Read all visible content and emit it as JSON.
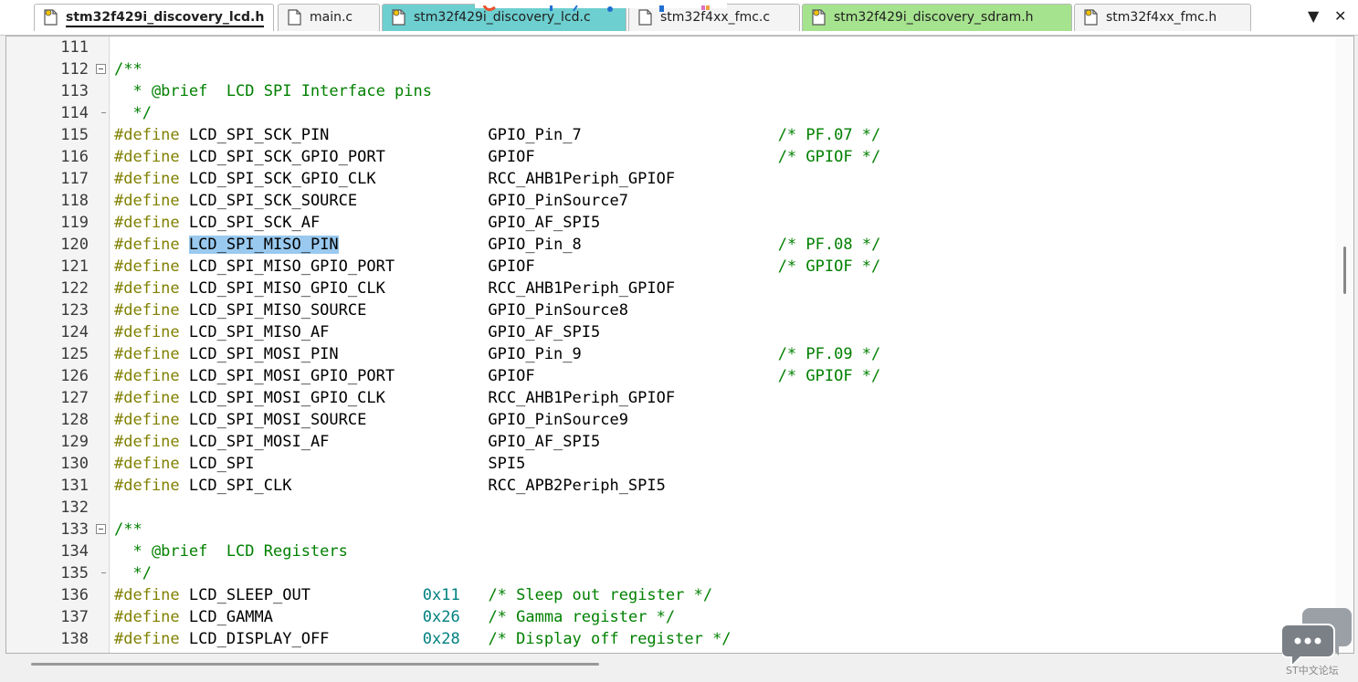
{
  "tabs": [
    {
      "label": "stm32f429i_discovery_lcd.h",
      "active": true,
      "bg": "#ffffff",
      "icon": "header-file-icon"
    },
    {
      "label": "main.c",
      "active": false,
      "bg": "#f4f4f4",
      "icon": "source-file-icon"
    },
    {
      "label": "stm32f429i_discovery_lcd.c",
      "active": false,
      "bg": "#6dcfcf",
      "icon": "header-file-icon"
    },
    {
      "label": "stm32f4xx_fmc.c",
      "active": false,
      "bg": "#f4f4f4",
      "icon": "source-file-icon"
    },
    {
      "label": "stm32f429i_discovery_sdram.h",
      "active": false,
      "bg": "#a6e38f",
      "icon": "header-file-icon"
    },
    {
      "label": "stm32f4xx_fmc.h",
      "active": false,
      "bg": "#f4f4f4",
      "icon": "header-file-icon"
    }
  ],
  "tab_controls": {
    "dropdown": "▼",
    "close": "✕"
  },
  "lines": [
    {
      "n": "111",
      "fold": "",
      "parts": []
    },
    {
      "n": "112",
      "fold": "box",
      "parts": [
        [
          "cm",
          "/**"
        ]
      ]
    },
    {
      "n": "113",
      "fold": "",
      "parts": [
        [
          "cm",
          "  * @brief  LCD SPI Interface pins"
        ]
      ]
    },
    {
      "n": "114",
      "fold": "tick",
      "parts": [
        [
          "cm",
          "  */"
        ]
      ]
    },
    {
      "n": "115",
      "fold": "",
      "parts": [
        [
          "kw",
          "#define"
        ],
        [
          "id",
          " LCD_SPI_SCK_PIN                 GPIO_Pin_7                     "
        ],
        [
          "cm",
          "/* PF.07 */"
        ]
      ]
    },
    {
      "n": "116",
      "fold": "",
      "parts": [
        [
          "kw",
          "#define"
        ],
        [
          "id",
          " LCD_SPI_SCK_GPIO_PORT           GPIOF                          "
        ],
        [
          "cm",
          "/* GPIOF */"
        ]
      ]
    },
    {
      "n": "117",
      "fold": "",
      "parts": [
        [
          "kw",
          "#define"
        ],
        [
          "id",
          " LCD_SPI_SCK_GPIO_CLK            RCC_AHB1Periph_GPIOF"
        ]
      ]
    },
    {
      "n": "118",
      "fold": "",
      "parts": [
        [
          "kw",
          "#define"
        ],
        [
          "id",
          " LCD_SPI_SCK_SOURCE              GPIO_PinSource7"
        ]
      ]
    },
    {
      "n": "119",
      "fold": "",
      "parts": [
        [
          "kw",
          "#define"
        ],
        [
          "id",
          " LCD_SPI_SCK_AF                  GPIO_AF_SPI5"
        ]
      ]
    },
    {
      "n": "120",
      "fold": "",
      "parts": [
        [
          "kw",
          "#define"
        ],
        [
          "id",
          " "
        ],
        [
          "sel",
          "LCD_SPI_MISO_PIN"
        ],
        [
          "id",
          "                GPIO_Pin_8                     "
        ],
        [
          "cm",
          "/* PF.08 */"
        ]
      ]
    },
    {
      "n": "121",
      "fold": "",
      "parts": [
        [
          "kw",
          "#define"
        ],
        [
          "id",
          " LCD_SPI_MISO_GPIO_PORT          GPIOF                          "
        ],
        [
          "cm",
          "/* GPIOF */"
        ]
      ]
    },
    {
      "n": "122",
      "fold": "",
      "parts": [
        [
          "kw",
          "#define"
        ],
        [
          "id",
          " LCD_SPI_MISO_GPIO_CLK           RCC_AHB1Periph_GPIOF"
        ]
      ]
    },
    {
      "n": "123",
      "fold": "",
      "parts": [
        [
          "kw",
          "#define"
        ],
        [
          "id",
          " LCD_SPI_MISO_SOURCE             GPIO_PinSource8"
        ]
      ]
    },
    {
      "n": "124",
      "fold": "",
      "parts": [
        [
          "kw",
          "#define"
        ],
        [
          "id",
          " LCD_SPI_MISO_AF                 GPIO_AF_SPI5"
        ]
      ]
    },
    {
      "n": "125",
      "fold": "",
      "parts": [
        [
          "kw",
          "#define"
        ],
        [
          "id",
          " LCD_SPI_MOSI_PIN                GPIO_Pin_9                     "
        ],
        [
          "cm",
          "/* PF.09 */"
        ]
      ]
    },
    {
      "n": "126",
      "fold": "",
      "parts": [
        [
          "kw",
          "#define"
        ],
        [
          "id",
          " LCD_SPI_MOSI_GPIO_PORT          GPIOF                          "
        ],
        [
          "cm",
          "/* GPIOF */"
        ]
      ]
    },
    {
      "n": "127",
      "fold": "",
      "parts": [
        [
          "kw",
          "#define"
        ],
        [
          "id",
          " LCD_SPI_MOSI_GPIO_CLK           RCC_AHB1Periph_GPIOF"
        ]
      ]
    },
    {
      "n": "128",
      "fold": "",
      "parts": [
        [
          "kw",
          "#define"
        ],
        [
          "id",
          " LCD_SPI_MOSI_SOURCE             GPIO_PinSource9"
        ]
      ]
    },
    {
      "n": "129",
      "fold": "",
      "parts": [
        [
          "kw",
          "#define"
        ],
        [
          "id",
          " LCD_SPI_MOSI_AF                 GPIO_AF_SPI5"
        ]
      ]
    },
    {
      "n": "130",
      "fold": "",
      "parts": [
        [
          "kw",
          "#define"
        ],
        [
          "id",
          " LCD_SPI                         SPI5"
        ]
      ]
    },
    {
      "n": "131",
      "fold": "",
      "parts": [
        [
          "kw",
          "#define"
        ],
        [
          "id",
          " LCD_SPI_CLK                     RCC_APB2Periph_SPI5"
        ]
      ]
    },
    {
      "n": "132",
      "fold": "",
      "parts": []
    },
    {
      "n": "133",
      "fold": "box",
      "parts": [
        [
          "cm",
          "/**"
        ]
      ]
    },
    {
      "n": "134",
      "fold": "",
      "parts": [
        [
          "cm",
          "  * @brief  LCD Registers"
        ]
      ]
    },
    {
      "n": "135",
      "fold": "tick",
      "parts": [
        [
          "cm",
          "  */"
        ]
      ]
    },
    {
      "n": "136",
      "fold": "",
      "parts": [
        [
          "kw",
          "#define"
        ],
        [
          "id",
          " LCD_SLEEP_OUT            "
        ],
        [
          "num",
          "0x11"
        ],
        [
          "id",
          "   "
        ],
        [
          "cm",
          "/* Sleep out register */"
        ]
      ]
    },
    {
      "n": "137",
      "fold": "",
      "parts": [
        [
          "kw",
          "#define"
        ],
        [
          "id",
          " LCD_GAMMA                "
        ],
        [
          "num",
          "0x26"
        ],
        [
          "id",
          "   "
        ],
        [
          "cm",
          "/* Gamma register */"
        ]
      ]
    },
    {
      "n": "138",
      "fold": "",
      "parts": [
        [
          "kw",
          "#define"
        ],
        [
          "id",
          " LCD_DISPLAY_OFF          "
        ],
        [
          "num",
          "0x28"
        ],
        [
          "id",
          "   "
        ],
        [
          "cm",
          "/* Display off register */"
        ]
      ]
    }
  ],
  "watermark": {
    "text": "ST中文论坛",
    "icon": "chat-bubbles-icon"
  }
}
